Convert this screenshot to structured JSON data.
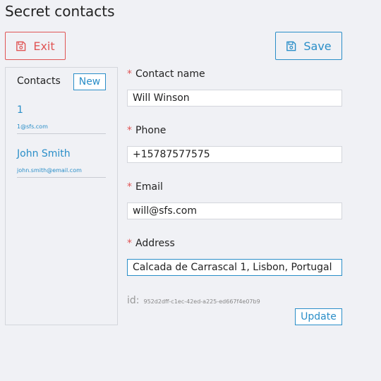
{
  "app": {
    "title": "Secret contacts"
  },
  "toolbar": {
    "exit_label": "Exit",
    "save_label": "Save"
  },
  "sidebar": {
    "header": "Contacts",
    "new_label": "New",
    "contacts": [
      {
        "name": "1",
        "email": "1@sfs.com"
      },
      {
        "name": "John Smith",
        "email": "john.smith@email.com"
      }
    ]
  },
  "form": {
    "fields": [
      {
        "label": "Contact name",
        "value": "Will Winson",
        "required": true
      },
      {
        "label": "Phone",
        "value": "+15787577575",
        "required": true
      },
      {
        "label": "Email",
        "value": "will@sfs.com",
        "required": true
      },
      {
        "label": "Address",
        "value": "Calcada de Carrascal 1, Lisbon, Portugal",
        "required": true
      }
    ],
    "required_marker": "*",
    "id_label": "id:",
    "id_value": "952d2dff-c1ec-42ed-a225-ed667f4e07b9",
    "update_label": "Update"
  },
  "colors": {
    "accent": "#2a8ec8",
    "danger": "#e05555",
    "background": "#f0f1f5"
  },
  "icons": {
    "exit": "floppy-disk-icon",
    "save": "floppy-disk-icon"
  }
}
